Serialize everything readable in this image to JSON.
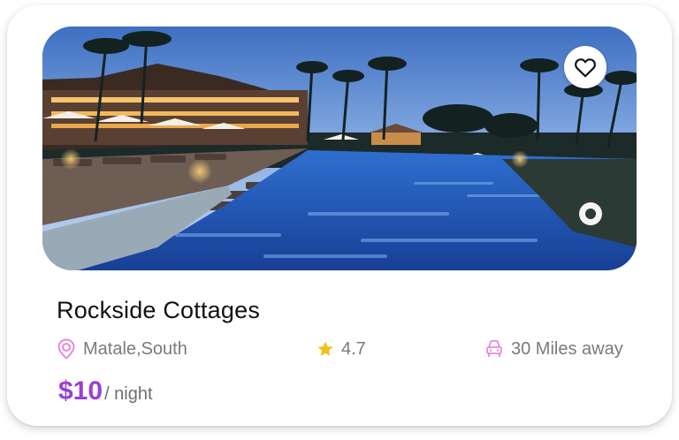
{
  "listing": {
    "title": "Rockside Cottages",
    "location": "Matale,South",
    "rating": "4.7",
    "distance": "30 Miles away",
    "price": "$10",
    "price_unit": "/ night",
    "image_subject": "resort pool with palm trees at dusk",
    "favorite_icon": "heart-outline-icon"
  },
  "icons": {
    "location": "map-pin-icon",
    "rating": "star-icon",
    "distance": "car-icon"
  },
  "colors": {
    "accent": "#9b3fd4",
    "icon_pink": "#e58ad8",
    "star": "#f2c21b",
    "muted_text": "#7a7a7a"
  }
}
